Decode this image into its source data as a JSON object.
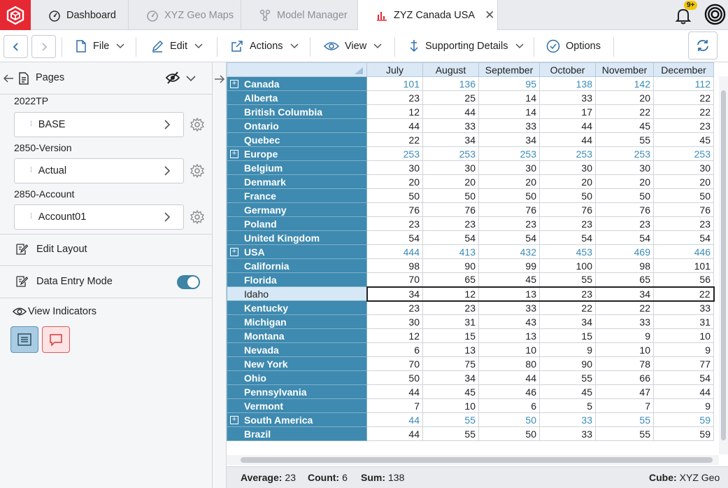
{
  "tabs": [
    {
      "label": "Dashboard",
      "icon": "speedometer-icon",
      "state": "normal"
    },
    {
      "label": "XYZ Geo Maps",
      "icon": "speedometer-icon",
      "state": "inactive"
    },
    {
      "label": "Model Manager",
      "icon": "model-nodes-icon",
      "state": "inactive"
    },
    {
      "label": "ZYZ Canada USA",
      "icon": "bar-chart-icon",
      "state": "active"
    }
  ],
  "notifications": {
    "badge": "9+"
  },
  "toolbar": {
    "file_label": "File",
    "edit_label": "Edit",
    "actions_label": "Actions",
    "view_label": "View",
    "supporting_details_label": "Supporting Details",
    "options_label": "Options"
  },
  "left_panel": {
    "pages_label": "Pages",
    "dimensions": [
      {
        "label": "2022TP",
        "value": "BASE"
      },
      {
        "label": "2850-Version",
        "value": "Actual"
      },
      {
        "label": "2850-Account",
        "value": "Account01"
      }
    ],
    "edit_layout_label": "Edit Layout",
    "data_entry_mode_label": "Data Entry Mode",
    "data_entry_mode_on": true,
    "view_indicators_label": "View Indicators"
  },
  "grid": {
    "columns": [
      "July",
      "August",
      "September",
      "October",
      "November",
      "December"
    ],
    "rows": [
      {
        "label": "Canada",
        "type": "parent",
        "values": [
          101,
          136,
          95,
          138,
          142,
          112
        ]
      },
      {
        "label": "Alberta",
        "type": "child",
        "values": [
          23,
          25,
          14,
          33,
          20,
          22
        ]
      },
      {
        "label": "British Columbia",
        "type": "child",
        "values": [
          12,
          44,
          14,
          17,
          22,
          22
        ]
      },
      {
        "label": "Ontario",
        "type": "child",
        "values": [
          44,
          33,
          33,
          44,
          45,
          23
        ]
      },
      {
        "label": "Quebec",
        "type": "child",
        "values": [
          22,
          34,
          34,
          44,
          55,
          45
        ]
      },
      {
        "label": "Europe",
        "type": "parent",
        "values": [
          253,
          253,
          253,
          253,
          253,
          253
        ]
      },
      {
        "label": "Belgium",
        "type": "child",
        "values": [
          30,
          30,
          30,
          30,
          30,
          30
        ]
      },
      {
        "label": "Denmark",
        "type": "child",
        "values": [
          20,
          20,
          20,
          20,
          20,
          20
        ]
      },
      {
        "label": "France",
        "type": "child",
        "values": [
          50,
          50,
          50,
          50,
          50,
          50
        ]
      },
      {
        "label": "Germany",
        "type": "child",
        "values": [
          76,
          76,
          76,
          76,
          76,
          76
        ]
      },
      {
        "label": "Poland",
        "type": "child",
        "values": [
          23,
          23,
          23,
          23,
          23,
          23
        ]
      },
      {
        "label": "United Kingdom",
        "type": "child",
        "values": [
          54,
          54,
          54,
          54,
          54,
          54
        ]
      },
      {
        "label": "USA",
        "type": "parent",
        "values": [
          444,
          413,
          432,
          453,
          469,
          446
        ]
      },
      {
        "label": "California",
        "type": "child",
        "values": [
          98,
          90,
          99,
          100,
          98,
          101
        ]
      },
      {
        "label": "Florida",
        "type": "child",
        "values": [
          70,
          65,
          45,
          55,
          65,
          56
        ]
      },
      {
        "label": "Idaho",
        "type": "child",
        "selected": true,
        "values": [
          34,
          12,
          13,
          23,
          34,
          22
        ]
      },
      {
        "label": "Kentucky",
        "type": "child",
        "values": [
          23,
          23,
          33,
          22,
          22,
          33
        ]
      },
      {
        "label": "Michigan",
        "type": "child",
        "values": [
          30,
          31,
          43,
          34,
          33,
          31
        ]
      },
      {
        "label": "Montana",
        "type": "child",
        "values": [
          12,
          15,
          13,
          15,
          9,
          10
        ]
      },
      {
        "label": "Nevada",
        "type": "child",
        "values": [
          6,
          13,
          10,
          9,
          10,
          9
        ]
      },
      {
        "label": "New York",
        "type": "child",
        "values": [
          70,
          75,
          80,
          90,
          78,
          77
        ]
      },
      {
        "label": "Ohio",
        "type": "child",
        "values": [
          50,
          34,
          44,
          55,
          66,
          54
        ]
      },
      {
        "label": "Pennsylvania",
        "type": "child",
        "values": [
          44,
          45,
          46,
          45,
          47,
          44
        ]
      },
      {
        "label": "Vermont",
        "type": "child",
        "values": [
          7,
          10,
          6,
          5,
          7,
          9
        ]
      },
      {
        "label": "South America",
        "type": "parent",
        "values": [
          44,
          55,
          50,
          33,
          55,
          59
        ]
      },
      {
        "label": "Brazil",
        "type": "child",
        "values": [
          44,
          55,
          50,
          33,
          55,
          59
        ]
      }
    ]
  },
  "status": {
    "average_label": "Average:",
    "average": "23",
    "count_label": "Count:",
    "count": "6",
    "sum_label": "Sum:",
    "sum": "138",
    "cube_label": "Cube:",
    "cube": "XYZ Geo"
  },
  "colors": {
    "brand_red": "#e62833",
    "row_header": "#3e8ab0",
    "parent_value": "#3a8bb8",
    "column_header": "#dbe9f6"
  }
}
